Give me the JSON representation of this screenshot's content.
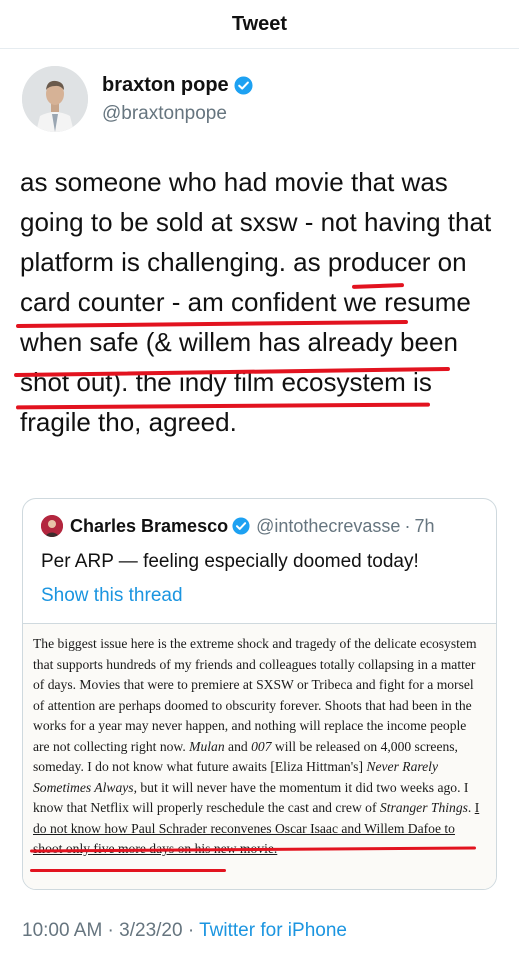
{
  "header": {
    "title": "Tweet"
  },
  "author": {
    "display_name": "braxton pope",
    "handle": "@braxtonpope"
  },
  "tweet": {
    "text": "as someone who had movie that was going to be sold at sxsw - not having that platform is challenging. as producer on card counter - am confident we resume when safe (& willem has already been shot out). the indy film ecosystem is fragile tho, agreed.",
    "annotation_color": "#e2131f"
  },
  "quote": {
    "display_name": "Charles Bramesco",
    "handle": "@intothecrevasse",
    "time": "7h",
    "text": "Per ARP — feeling especially doomed today!",
    "show_thread": "Show this thread",
    "excerpt": {
      "part1": "The biggest issue here is the extreme shock and tragedy of the delicate ecosystem that supports hundreds of my friends and colleagues totally collapsing in a matter of days. Movies that were to premiere at SXSW or Tribeca and fight for a morsel of attention are perhaps doomed to obscurity forever. Shoots that had been in the works for a year may never happen, and nothing will replace the income people are not collecting right now. ",
      "mulan": "Mulan",
      "part2": " and ",
      "bond": "007",
      "part3": " will be released on 4,000 screens, someday. I do not know what future awaits [Eliza Hittman's] ",
      "nrsa": "Never Rarely Sometimes Always",
      "part4": ", but it will never have the momentum it did two weeks ago. I know that Netflix will properly reschedule the cast and crew of ",
      "stranger": "Stranger Things",
      "part5": ". ",
      "underlined": "I do not know how Paul Schrader reconvenes Oscar Isaac and Willem Dafoe to shoot only five more days on his new movie."
    }
  },
  "footer": {
    "time": "10:00 AM",
    "date": "3/23/20",
    "source": "Twitter for iPhone",
    "separator": " · "
  },
  "colors": {
    "link": "#1b95e0",
    "verified": "#1da1f2",
    "secondary_text": "#66757f",
    "border": "#cfd9de"
  }
}
